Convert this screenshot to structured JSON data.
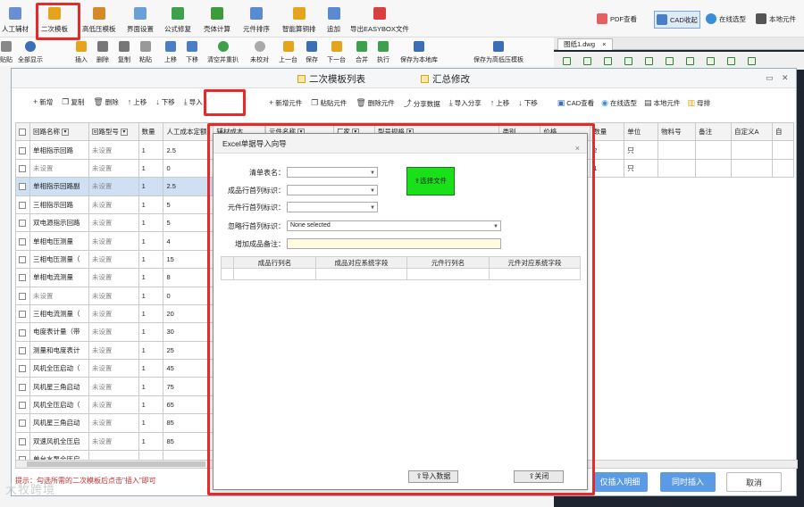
{
  "ribbon": {
    "items": [
      "人工辅材",
      "二次模板",
      "高低压模板",
      "界面设置",
      "公式修复",
      "壳体计算",
      "元件排序",
      "智能算铜排",
      "追加",
      "导出EASYBOX文件"
    ],
    "right": [
      "PDF查看",
      "CAD收起",
      "在线选型",
      "本地元件"
    ]
  },
  "toolbar2": {
    "left": [
      "贴贴",
      "全部显示"
    ],
    "items": [
      "插入",
      "删除",
      "复制",
      "粘贴",
      "上移",
      "下移",
      "清空并重扒",
      "未校对",
      "上一台",
      "保存",
      "下一台",
      "合并",
      "执行",
      "保存为本地库",
      "保存为高低压模板"
    ]
  },
  "cad": {
    "tab": "图纸1.dwg",
    "close": "×"
  },
  "window": {
    "title_left": "二次模板列表",
    "title_right": "汇总修改",
    "controls": [
      "▭",
      "✕"
    ]
  },
  "left_toolbar": [
    "新增",
    "复制",
    "删除",
    "上移",
    "下移",
    "导入"
  ],
  "right_toolbar": [
    "新增元件",
    "粘贴元件",
    "删除元件",
    "分享数据",
    "导入分享",
    "上移",
    "下移",
    "CAD查看",
    "在线选型",
    "本地元件",
    "母排"
  ],
  "left_table": {
    "headers": [
      "回路名称",
      "回路型号",
      "数量",
      "人工成本定额",
      "辅材成本"
    ],
    "rows": [
      [
        "单相指示回路",
        "未设置",
        "1",
        "2.5"
      ],
      [
        "未设置",
        "未设置",
        "1",
        "0"
      ],
      [
        "单相指示回路副",
        "未设置",
        "1",
        "2.5"
      ],
      [
        "三相指示回路",
        "未设置",
        "1",
        "5"
      ],
      [
        "双电源指示回路",
        "未设置",
        "1",
        "5"
      ],
      [
        "单相电压测量",
        "未设置",
        "1",
        "4"
      ],
      [
        "三相电压测量（",
        "未设置",
        "1",
        "15"
      ],
      [
        "单相电流测量",
        "未设置",
        "1",
        "8"
      ],
      [
        "未设置",
        "未设置",
        "1",
        "0"
      ],
      [
        "三相电流测量（",
        "未设置",
        "1",
        "20"
      ],
      [
        "电度表计量（带",
        "未设置",
        "1",
        "30"
      ],
      [
        "测量和电度表计",
        "未设置",
        "1",
        "25"
      ],
      [
        "风机全压启动（",
        "未设置",
        "1",
        "45"
      ],
      [
        "风机星三角启动",
        "未设置",
        "1",
        "75"
      ],
      [
        "风机全压启动（",
        "未设置",
        "1",
        "65"
      ],
      [
        "风机星三角启动",
        "未设置",
        "1",
        "85"
      ],
      [
        "双速风机全压启",
        "未设置",
        "1",
        "85"
      ],
      [
        "单台水泵全压启",
        "",
        "",
        ""
      ]
    ]
  },
  "right_table": {
    "headers": [
      "元件名称",
      "厂家",
      "型号规格",
      "类别",
      "价格",
      "数量",
      "单位",
      "物料号",
      "备注",
      "自定义A",
      "自"
    ],
    "rows": [
      [
        "",
        "",
        "",
        "",
        "",
        "2",
        "只",
        "",
        "",
        "",
        ""
      ],
      [
        "",
        "",
        "",
        "",
        "",
        "1",
        "只",
        "",
        "",
        "",
        ""
      ]
    ]
  },
  "bottom": {
    "note": "提示：勾选所需的二次模板后点击\"插入\"即可",
    "buttons": [
      "仅插入明细",
      "同时插入",
      "取消"
    ]
  },
  "dialog": {
    "title": "Excel单据导入向导",
    "close": "×",
    "fields": [
      {
        "label": "清单表名：",
        "value": ""
      },
      {
        "label": "成品行首列标识：",
        "value": ""
      },
      {
        "label": "元件行首列标识：",
        "value": ""
      },
      {
        "label": "忽略行首列标识：",
        "value": "None selected"
      },
      {
        "label": "增加成品备注：",
        "value": ""
      }
    ],
    "choose_file": "选择文件",
    "map_headers": [
      "",
      "成品行列名",
      "成品对应系统字段",
      "元件行列名",
      "元件对应系统字段"
    ],
    "import_button": "导入数据",
    "close_button": "关闭"
  },
  "watermark": "大牧跨境",
  "colors": {
    "highlight": "#e52a2a",
    "primary_button": "#5b9be6",
    "choose_file": "#19e019",
    "selected_row": "#cfe0f5"
  }
}
